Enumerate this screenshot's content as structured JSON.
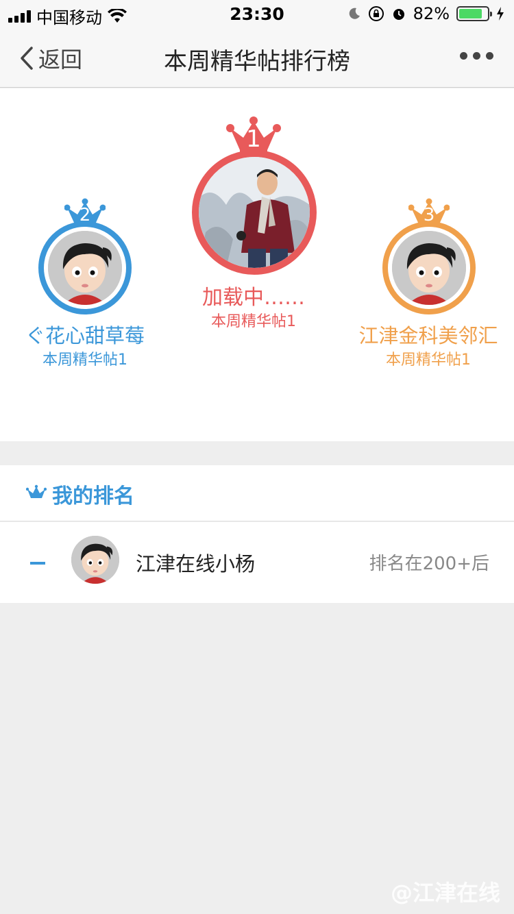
{
  "status_bar": {
    "carrier": "中国移动",
    "time": "23:30",
    "battery": "82%",
    "battery_level": 0.82
  },
  "nav": {
    "back_label": "返回",
    "title": "本周精华帖排行榜"
  },
  "podium": [
    {
      "rank": "1",
      "name": "加载中……",
      "subtitle": "本周精华帖1",
      "color": "#e85a5a"
    },
    {
      "rank": "2",
      "name": "ぐ花心甜草莓",
      "subtitle": "本周精华帖1",
      "color": "#3b97d9"
    },
    {
      "rank": "3",
      "name": "江津金科美邻汇",
      "subtitle": "本周精华帖1",
      "color": "#f0a04b"
    }
  ],
  "my_rank": {
    "header": "我的排名",
    "rank_value": "–",
    "name": "江津在线小杨",
    "status": "排名在200+后"
  },
  "watermark": "@江津在线",
  "colors": {
    "primary_blue": "#3b97d9",
    "gold_red": "#e85a5a",
    "orange": "#f0a04b",
    "bg_gray": "#eeeeee"
  }
}
